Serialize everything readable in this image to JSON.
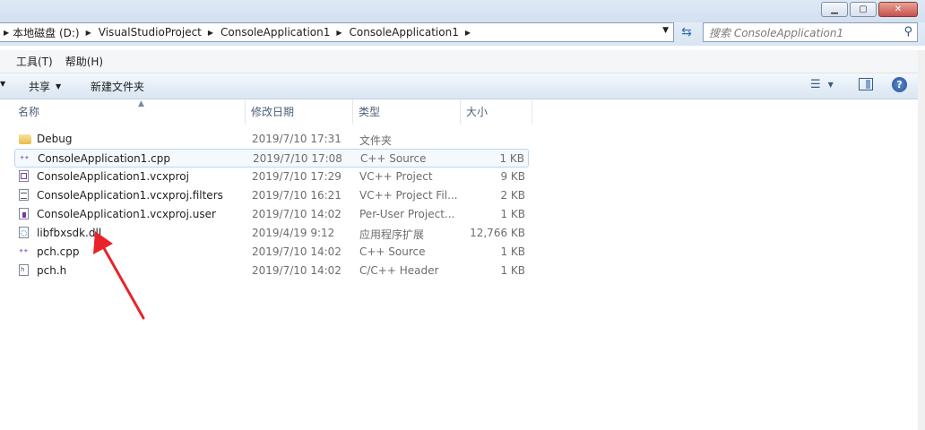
{
  "window": {
    "buttons": [
      "minimize",
      "maximize",
      "close"
    ]
  },
  "address": {
    "crumbs": [
      "本地磁盘 (D:)",
      "VisualStudioProject",
      "ConsoleApplication1",
      "ConsoleApplication1"
    ]
  },
  "search": {
    "placeholder": "搜索 ConsoleApplication1"
  },
  "menu": {
    "tools": "工具(T)",
    "help": "帮助(H)"
  },
  "commands": {
    "share": "共享",
    "new_folder": "新建文件夹"
  },
  "columns": {
    "name": "名称",
    "date": "修改日期",
    "type": "类型",
    "size": "大小"
  },
  "files": [
    {
      "name": "Debug",
      "date": "2019/7/10 17:31",
      "type": "文件夹",
      "size": "",
      "icon": "folder-icon"
    },
    {
      "name": "ConsoleApplication1.cpp",
      "date": "2019/7/10 17:08",
      "type": "C++ Source",
      "size": "1 KB",
      "icon": "cpp-file-icon",
      "selected": true
    },
    {
      "name": "ConsoleApplication1.vcxproj",
      "date": "2019/7/10 17:29",
      "type": "VC++ Project",
      "size": "9 KB",
      "icon": "vcxproj-file-icon"
    },
    {
      "name": "ConsoleApplication1.vcxproj.filters",
      "date": "2019/7/10 16:21",
      "type": "VC++ Project Fil...",
      "size": "2 KB",
      "icon": "filters-file-icon"
    },
    {
      "name": "ConsoleApplication1.vcxproj.user",
      "date": "2019/7/10 14:02",
      "type": "Per-User Project...",
      "size": "1 KB",
      "icon": "user-file-icon"
    },
    {
      "name": "libfbxsdk.dll",
      "date": "2019/4/19 9:12",
      "type": "应用程序扩展",
      "size": "12,766 KB",
      "icon": "dll-file-icon"
    },
    {
      "name": "pch.cpp",
      "date": "2019/7/10 14:02",
      "type": "C++ Source",
      "size": "1 KB",
      "icon": "cpp-file-icon"
    },
    {
      "name": "pch.h",
      "date": "2019/7/10 14:02",
      "type": "C/C++ Header",
      "size": "1 KB",
      "icon": "header-file-icon"
    }
  ],
  "annotation": {
    "arrow_color": "#e8242a"
  }
}
